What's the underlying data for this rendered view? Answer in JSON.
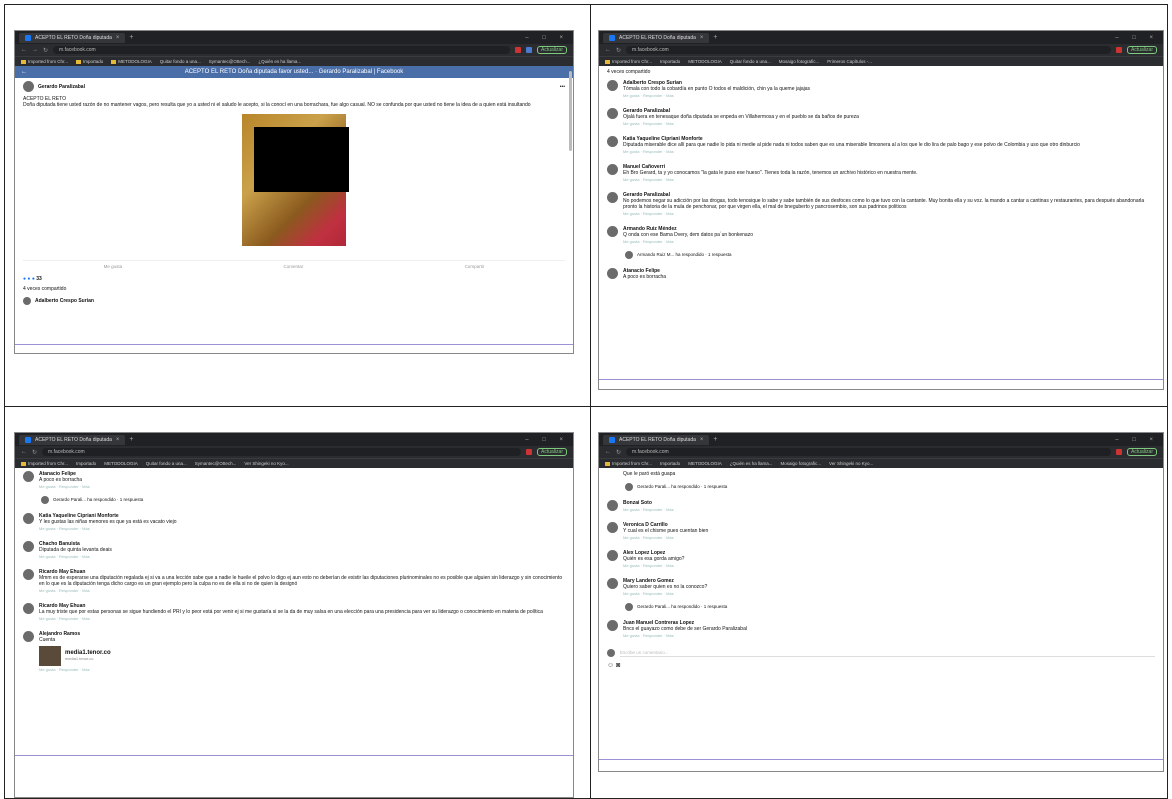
{
  "browser": {
    "tab_title": "ACEPTO EL RETO Doña diputada",
    "tab_close": "×",
    "new_tab": "+",
    "url": "m.facebook.com",
    "update_btn": "Actualizar",
    "bookmarks": [
      "Imported from Chr...",
      "Importado",
      "METODOLOGIA",
      "Quitar fondo a una...",
      "Symantec@Ottech...",
      "¿Quién es ha llama...",
      "Mosaigo fotografic...",
      "Primeros Capítulos -...",
      "Ver Shingeki no Kyo..."
    ],
    "accent_color": "#1877f2",
    "chrome_color": "#202124"
  },
  "panel1": {
    "fb_header": "ACEPTO EL RETO Doña diputada favor usted... · Gerardo Paralizabal | Facebook",
    "author": "Gerardo Paralizabal",
    "post_title": "ACEPTO EL RETO",
    "post_text": "Doña diputada tiene usted razón de no mantener vagos, pero resulta que yo a usted ni el saludo le acepto, si la conocí en una borrachara, fue algo casual. NO se confunda por que usted no tiene la idea de a quien está insultando",
    "actions": [
      "Me gusta",
      "Comentar",
      "Compartir"
    ],
    "reactions_count": "33",
    "shares": "4 veces compartido",
    "first_commenter": "Adalberto Crespo Surian"
  },
  "panel2": {
    "shares": "4 veces compartido",
    "meta": "Me gusta · Responder · Más",
    "comments": [
      {
        "name": "Adalberto Crespo Surian",
        "text": "Tómala con todo la cobardía en punto O todos el maldición, chin ya la queme jajajas"
      },
      {
        "name": "Gerardo Paralizabal",
        "text": "Ojalá fuera en tenesaque doña diputada se enpeda en Villahermosa y en el pueblo se da baños de pureza"
      },
      {
        "name": "Katia Yaquelíne Cipriani Monforte",
        "text": "Diputada miserable dice allí para que nadie lo pida ni medie al pide nada ni todos saben que es una miserable limosnera al a los que le dio lira de palo bago y ese polvo de Colombia y uso que otro dinburcio"
      },
      {
        "name": "Manuel Cañoverri",
        "text": "Eh Bro Gerard, ta y yo conocamos \"la gata le puso ese hueso\". Tienes toda la razón, tenemos un archivo histórico en nuestra mente."
      },
      {
        "name": "Gerardo Paralizabal",
        "text": "No podemos negar su adicción por las drogas, todo tenosique lo sabe y sabe también de sus desfoces como lo que tuvo con la cantante. Muy bonita ella y su voz. la mando a cantar a cantinas y restaurantes, para después abandonarla pronto la historia de la mula de penchonar, por que virgen ella, el mal de bneguberto y pancrosembio, son sus padrinos politicos"
      },
      {
        "name": "Armando Ruiz Méndez",
        "text": "Q onda con ese Bama Dvery, dem datos pa´un bonkenazo"
      }
    ],
    "reply_line": "Armando Ruiz M... ha respondido · 1 respuesta",
    "last": {
      "name": "Atanacio Felipe",
      "text": "A poco es borracha"
    }
  },
  "panel3": {
    "meta": "Me gusta · Responder · Más",
    "comments": [
      {
        "name": "Atanacio Felipe",
        "text": "A poco es borracha"
      },
      {
        "name": "Katia Yaquelíne Cipriani Monforte",
        "text": "Y les gustas las niñas menores es que ya está es vacato viejo"
      },
      {
        "name": "Chacho Banuista",
        "text": "Diputada de quinta levanta deais"
      },
      {
        "name": "Ricardo May Ehuan",
        "text": "Mmm es de esperarse una diputación regalada ej si va a una lección sabe que a nadie le hueile el polvo lo digo ej aun esto no deberían de existir las diputaciones plurinominales no es posible que alguien sin liderazgo y sin conocimiento en lo que es la diputación tenga dicho cargo es un gran ejemplo pero la culpa no es de ella si no de quien la designó"
      },
      {
        "name": "Ricardo May Ehuan",
        "text": "La muy triste que por estas personas se sigue hundiendo el PRI y lo peor está por venir ej si me gustaría si se la da de muy salsa en una elección para una presidencia para ver su liderazgo o conocimiento en materia de política"
      },
      {
        "name": "Alejandro Ramos",
        "text": "Cuenta"
      }
    ],
    "reply_line": "Gerardo Parali... ha respondido · 1 respuesta",
    "link_title": "media1.tenor.co",
    "link_sub": "media1.tenor.co"
  },
  "panel4": {
    "top_text": "Que le paró está guapa",
    "meta": "Me gusta · Responder · Más",
    "reply_line": "Gerardo Parali... ha respondido · 1 respuesta",
    "comments": [
      {
        "name": "Bonzai Soto",
        "text": ""
      },
      {
        "name": "Veronica D Carrillo",
        "text": "Y cual es el chisme pues cuentan bien"
      },
      {
        "name": "Alex Lopez Lopez",
        "text": "Quién es esa gorda amigo?"
      },
      {
        "name": "Mary Landero Gomez",
        "text": "Quiero saber quien es no la conozco?"
      },
      {
        "name": "Juan Manuel Contreras Lopez",
        "text": "Bncs el guayazo como debe de ser Gerardo Paralizabal"
      }
    ],
    "composer": "Escribe un comentario..."
  }
}
